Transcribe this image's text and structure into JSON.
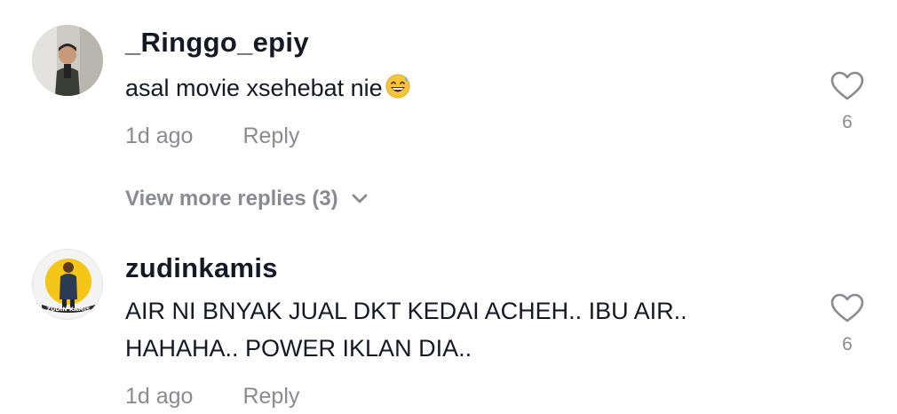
{
  "comments": [
    {
      "username": "_Ringgo_epiy",
      "text": "asal movie xsehebat nie",
      "emoji": "grinning-sweat-emoji",
      "time": "1d ago",
      "reply_label": "Reply",
      "likes": "6",
      "icon": "heart-outline-icon"
    },
    {
      "username": "zudinkamis",
      "text_lines": [
        "AIR NI BNYAK JUAL DKT KEDAI ACHEH.. IBU AIR..",
        "HAHAHA.. POWER IKLAN DIA.."
      ],
      "avatar_logo_text": "ZUDIN KAMIS",
      "time": "1d ago",
      "reply_label": "Reply",
      "likes": "6",
      "icon": "heart-outline-icon"
    }
  ],
  "view_more": {
    "label": "View more replies (3)",
    "icon": "chevron-down-icon"
  },
  "colors": {
    "primary_text": "#161823",
    "secondary_text": "#8a8b91",
    "heart_stroke": "#8a8b91",
    "avatar2_ring": "#f5c518"
  }
}
